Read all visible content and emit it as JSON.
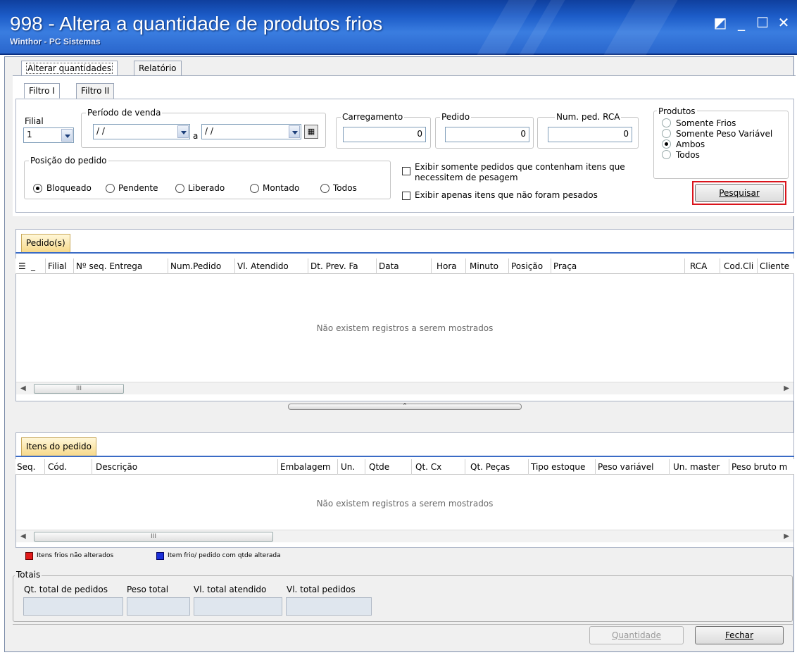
{
  "window": {
    "title": "998 - Altera a quantidade de produtos frios",
    "subtitle": "Winthor - PC Sistemas",
    "buttons": [
      "◩",
      "_",
      "☐",
      "✕"
    ]
  },
  "tabs": {
    "main": [
      "Alterar quantidades",
      "Relatório"
    ],
    "sub": [
      "Filtro I",
      "Filtro II"
    ]
  },
  "filter": {
    "filial_label": "Filial",
    "filial_value": "1",
    "periodo_label": "Período de venda",
    "periodo_from": "/ /",
    "periodo_sep": "a",
    "periodo_to": "/ /",
    "carregamento_label": "Carregamento",
    "carregamento_value": "0",
    "pedido_label": "Pedido",
    "pedido_value": "0",
    "numped_label": "Num. ped. RCA",
    "numped_value": "0",
    "produtos_label": "Produtos",
    "produtos_options": [
      "Somente Frios",
      "Somente Peso Variável",
      "Ambos",
      "Todos"
    ],
    "produtos_selected": "Ambos",
    "posicao_label": "Posição do pedido",
    "posicao_options": [
      "Bloqueado",
      "Pendente",
      "Liberado",
      "Montado",
      "Todos"
    ],
    "posicao_selected": "Bloqueado",
    "chk1_line1": "Exibir somente pedidos que contenham itens que",
    "chk1_line2": "necessitem  de pesagem",
    "chk2": "Exibir apenas itens que não foram pesados",
    "pesquisar": "Pesquisar"
  },
  "pedidos": {
    "tab": "Pedido(s)",
    "columns": [
      "Filial",
      "Nº seq. Entrega",
      "Num.Pedido",
      "Vl. Atendido",
      "Dt. Prev. Fa",
      "Data",
      "Hora",
      "Minuto",
      "Posição",
      "Praça",
      "RCA",
      "Cod.Cli",
      "Cliente"
    ],
    "empty": "Não existem registros a serem mostrados",
    "scroll_grip": "III"
  },
  "itens": {
    "tab": "Itens do pedido",
    "columns": [
      "Seq.",
      "Cód.",
      "Descrição",
      "Embalagem",
      "Un.",
      "Qtde",
      "Qt. Cx",
      "Qt. Peças",
      "Tipo estoque",
      "Peso variável",
      "Un. master",
      "Peso bruto m"
    ],
    "empty": "Não existem registros a serem mostrados",
    "scroll_grip": "III"
  },
  "legend": {
    "red_label": "Itens frios não alterados",
    "blue_label": "Item frio/ pedido com qtde alterada",
    "red": "#e01a1a",
    "blue": "#1a2fd8"
  },
  "totais": {
    "label": "Totais",
    "fields": [
      "Qt. total de pedidos",
      "Peso total",
      "Vl. total atendido",
      "Vl. total pedidos"
    ]
  },
  "footer": {
    "quantidade": "Quantidade",
    "fechar": "Fechar"
  },
  "highlight": "#d9141c"
}
